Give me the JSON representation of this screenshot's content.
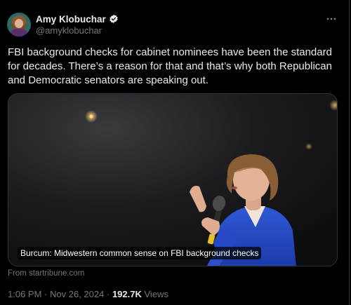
{
  "author": {
    "display_name": "Amy Klobuchar",
    "handle": "@amyklobuchar",
    "verified": true
  },
  "tweet": {
    "text": "FBI background checks for cabinet nominees have been the standard for decades. There’s a reason for that and that’s why both Republican and Democratic senators are speaking out."
  },
  "media": {
    "caption": "Burcum: Midwestern common sense on FBI background checks",
    "source": "From startribune.com"
  },
  "meta": {
    "time": "1:06 PM",
    "date": "Nov 26, 2024",
    "separator": "·",
    "views_count": "192.7K",
    "views_label": "Views"
  },
  "icons": {
    "verified": "verified-badge-icon",
    "more": "more-options-icon"
  },
  "colors": {
    "background": "#000000",
    "text_primary": "#e7e9ea",
    "text_secondary": "#71767b",
    "verified_blue": "#1d9bf0",
    "border": "#2f3336"
  }
}
